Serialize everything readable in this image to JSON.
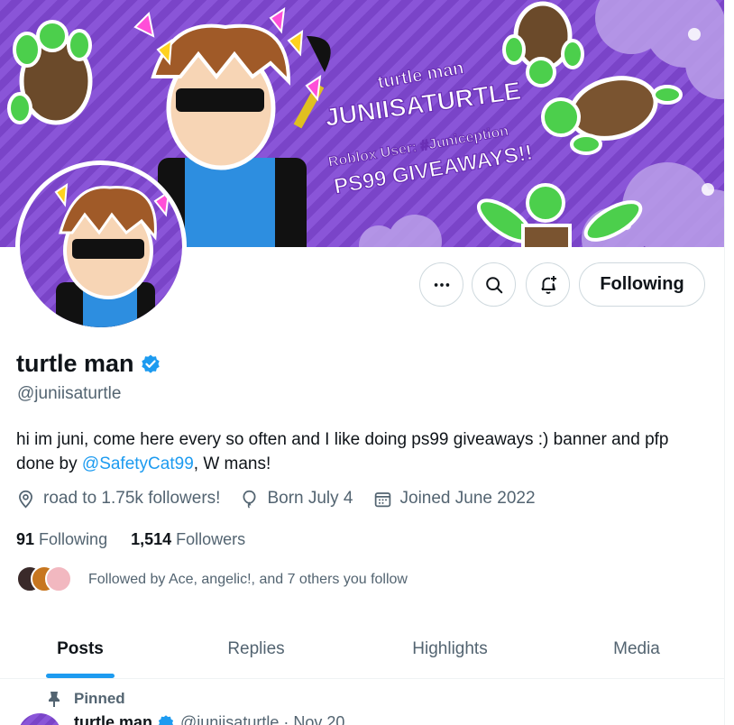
{
  "profile": {
    "display_name": "turtle man",
    "handle": "@juniisaturtle",
    "bio_text_1": "hi im juni, come here every so often and I like doing ps99 giveaways :) banner and pfp done by ",
    "bio_mention": "@SafetyCat99",
    "bio_text_2": ", W mans!",
    "location": "road to 1.75k followers!",
    "birthday": "Born July 4",
    "joined": "Joined June 2022",
    "following_count": "91",
    "following_label": "Following",
    "followers_count": "1,514",
    "followers_label": "Followers",
    "followed_by": "Followed by Ace, angelic!, and 7 others you follow"
  },
  "banner": {
    "line_1": "turtle man",
    "line_2": "JUNIISATURTLE",
    "line_3": "Roblox User: #Juniception",
    "line_4": "PS99 GIVEAWAYS!!"
  },
  "actions": {
    "more_icon": "more-icon",
    "search_icon": "search-icon",
    "notify_icon": "bell-plus-icon",
    "follow_label": "Following"
  },
  "tabs": [
    {
      "label": "Posts",
      "active": true
    },
    {
      "label": "Replies",
      "active": false
    },
    {
      "label": "Highlights",
      "active": false
    },
    {
      "label": "Media",
      "active": false
    }
  ],
  "pinned_post": {
    "pinned_label": "Pinned",
    "author": "turtle man",
    "handle_date": "@juniisaturtle · Nov 20"
  },
  "colors": {
    "accent": "#1d9bf0",
    "banner_purple": "#8a55d8",
    "muted_text": "#536471"
  }
}
